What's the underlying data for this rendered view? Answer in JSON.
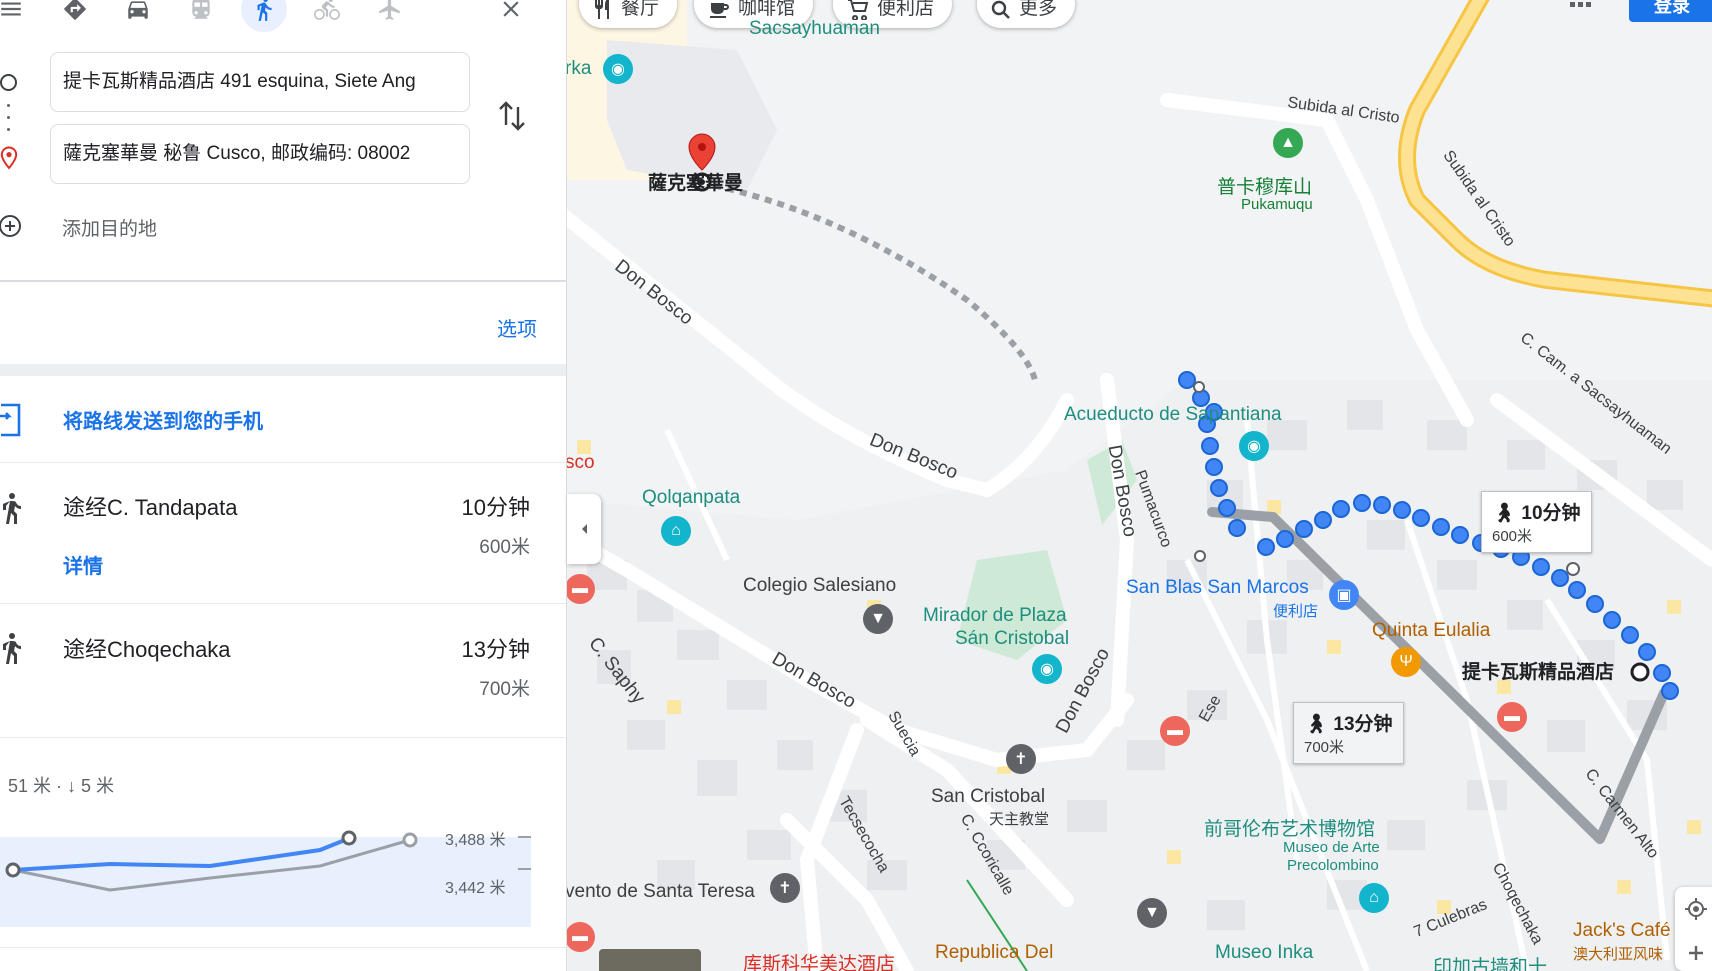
{
  "directions": {
    "modes": [
      {
        "name": "best-route",
        "icon": "diamond-route-icon"
      },
      {
        "name": "driving",
        "icon": "car-icon"
      },
      {
        "name": "transit",
        "icon": "train-icon"
      },
      {
        "name": "walking",
        "icon": "walk-icon",
        "active": true
      },
      {
        "name": "cycling",
        "icon": "bike-icon"
      },
      {
        "name": "flights",
        "icon": "plane-icon"
      }
    ],
    "origin_value": "提卡瓦斯精品酒店 491 esquina, Siete Ang",
    "destination_value": "薩克塞華曼 秘鲁 Cusco, 邮政编码: 08002",
    "add_destination_label": "添加目的地",
    "options_label": "选项",
    "send_to_phone_label": "将路线发送到您的手机",
    "routes": [
      {
        "title": "途经C. Tandapata",
        "time": "10分钟",
        "distance": "600米",
        "details_label": "详情"
      },
      {
        "title": "途经Choqechaka",
        "time": "13分钟",
        "distance": "700米"
      }
    ],
    "elevation": {
      "summary": "51 米 · ↓ 5 米",
      "high_label": "3,488 米",
      "low_label": "3,442 米"
    }
  },
  "map": {
    "chips": [
      {
        "label": "餐厅",
        "icon": "fork-knife-icon"
      },
      {
        "label": "咖啡馆",
        "icon": "coffee-icon"
      },
      {
        "label": "便利店",
        "icon": "cart-icon"
      },
      {
        "label": "更多",
        "icon": "search-icon"
      }
    ],
    "signin_label": "登录",
    "labels": {
      "sacsayhuaman_top": "Sacsayhuaman",
      "destination_name": "薩克塞華曼",
      "origin_name": "提卡瓦斯精品酒店",
      "subida_cristo": "Subida al Cristo",
      "subida_cristo_2": "Subida al Cristo",
      "pukamuqu_cn": "普卡穆库山",
      "pukamuqu": "Pukamuqu",
      "don_bosco_1": "Don Bosco",
      "don_bosco_2": "Don Bosco",
      "don_bosco_3": "Don Bosco",
      "don_bosco_4": "Don Bosco",
      "don_bosco_5": "Don Bosco",
      "cam_sacsayhuaman": "C. Cam. a Sacsayhuaman",
      "acueducto": "Acueducto de Sapantiana",
      "pumacurco": "Pumacurco",
      "qolqanpata": "Qolqanpata",
      "colegio": "Colegio Salesiano",
      "mirador_1": "Mirador de Plaza",
      "mirador_2": "Sán Cristobal",
      "san_blas": "San Blas San Marcos",
      "san_blas_sub": "便利店",
      "quinta": "Quinta Eulalia",
      "c_saphy": "C. Saphy",
      "suecia": "Suecia",
      "ese": "Ese",
      "tecsecocha": "Tecsecocha",
      "ccoricalle": "C. Ccoricalle",
      "san_cristobal": "San Cristobal",
      "san_cristobal_sub": "天主教堂",
      "precolombino_cn": "前哥伦布艺术博物馆",
      "precolombino_1": "Museo de Arte",
      "precolombino_2": "Precolombino",
      "carmen_alto": "C. Carmen Alto",
      "choqechaka": "Choqechaka",
      "culebras": "7 Culebras",
      "santa_teresa": "vento de Santa Teresa",
      "republica": "Republica Del",
      "museo_inka": "Museo Inka",
      "jacks": "Jack's Café",
      "jacks_sub": "澳大利亚风味",
      "hotel_bottom": "库斯科华美达酒店",
      "inka_cn": "印加古墙和十",
      "sco": "sco",
      "rka": "rka"
    },
    "callouts": [
      {
        "time": "10分钟",
        "distance": "600米"
      },
      {
        "time": "13分钟",
        "distance": "700米"
      }
    ]
  }
}
